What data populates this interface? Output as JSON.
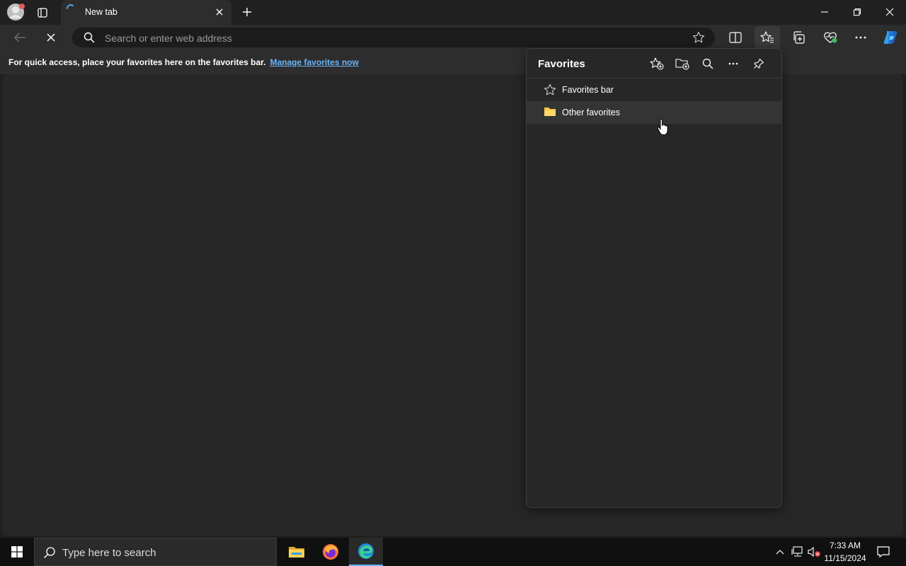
{
  "browser": {
    "tab_title": "New tab",
    "address_placeholder": "Search or enter web address"
  },
  "favorites_bar": {
    "message": "For quick access, place your favorites here on the favorites bar.",
    "link": "Manage favorites now"
  },
  "favorites_panel": {
    "title": "Favorites",
    "items": [
      {
        "label": "Favorites bar",
        "icon": "star-icon"
      },
      {
        "label": "Other favorites",
        "icon": "folder-icon"
      }
    ]
  },
  "taskbar": {
    "search_placeholder": "Type here to search",
    "time": "7:33 AM",
    "date": "11/15/2024",
    "apps": [
      "file-explorer",
      "firefox",
      "edge"
    ]
  },
  "colors": {
    "accent": "#6cb4f7",
    "folder": "#f7c94a"
  }
}
